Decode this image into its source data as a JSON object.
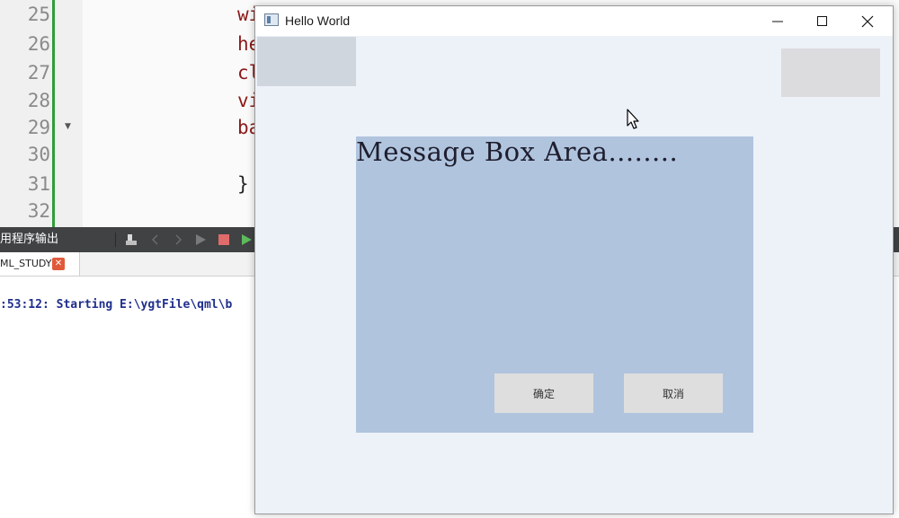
{
  "editor": {
    "lines": [
      {
        "num": "25",
        "code": "wi"
      },
      {
        "num": "26",
        "code": "he"
      },
      {
        "num": "27",
        "code": "cl"
      },
      {
        "num": "28",
        "code": "vi"
      },
      {
        "num": "29",
        "code": "ba"
      },
      {
        "num": "30",
        "code": ""
      },
      {
        "num": "31",
        "code": "}"
      },
      {
        "num": "32",
        "code": ""
      }
    ]
  },
  "output_panel": {
    "title": "用程序输出",
    "tab_label": "ML_STUDY",
    "log_line": ":53:12: Starting E:\\ygtFile\\qml\\b"
  },
  "window": {
    "title": "Hello World",
    "message_text": "Message Box Area........",
    "ok_label": "确定",
    "cancel_label": "取消"
  },
  "colors": {
    "message_box": "#b0c4de",
    "window_bg": "#edf2f9",
    "button_bg": "#dedede"
  }
}
